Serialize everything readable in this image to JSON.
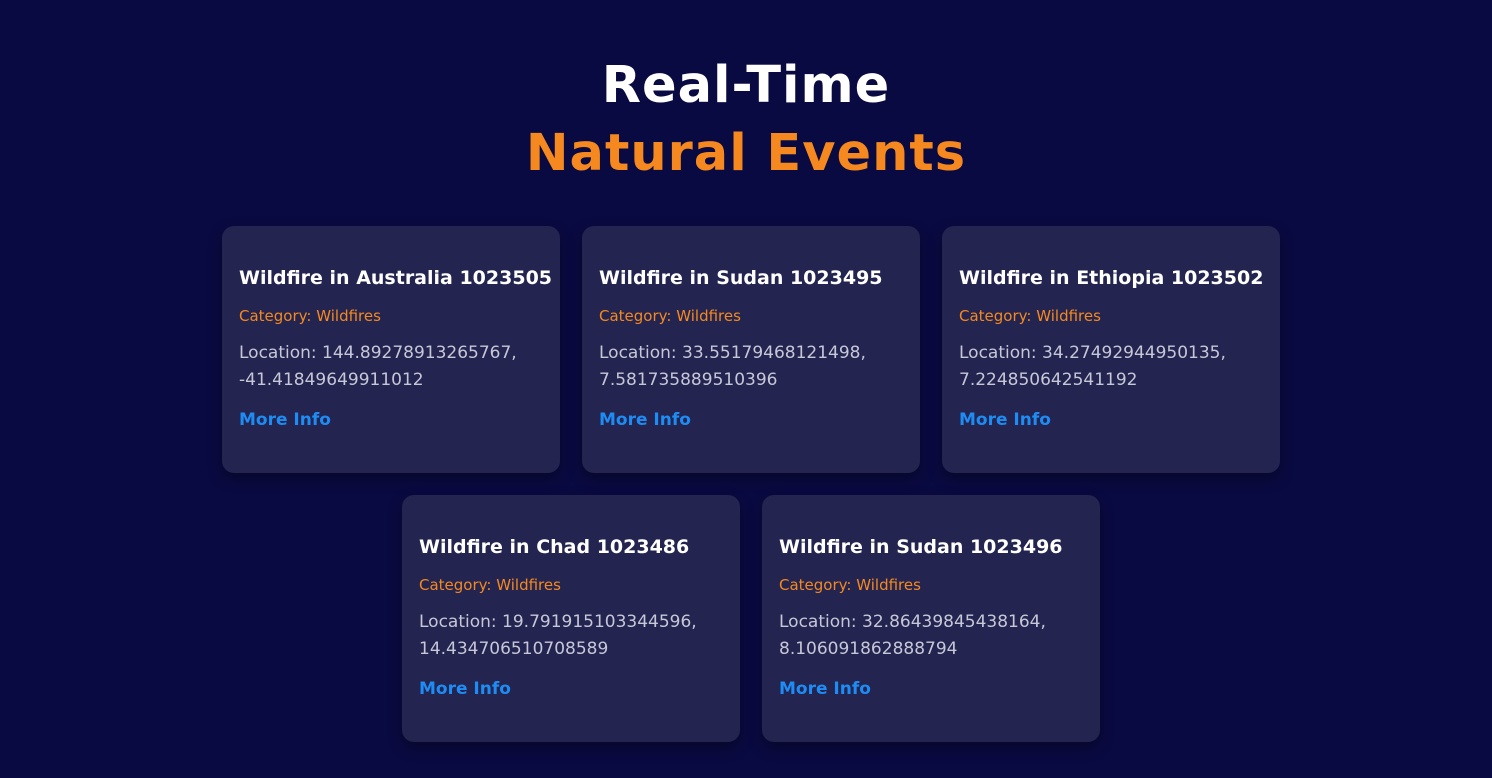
{
  "hero": {
    "line1": "Real-Time",
    "line2": "Natural Events"
  },
  "colors": {
    "background": "#0a0a42",
    "card": "#23244f",
    "accent": "#f5891f",
    "link": "#1e8cf5"
  },
  "events": [
    {
      "title": "Wildfire in Australia 1023505",
      "category": "Category: Wildfires",
      "location_line1": "Location: 144.89278913265767,",
      "location_line2": "-41.41849649911012",
      "link_label": "More Info"
    },
    {
      "title": "Wildfire in Sudan 1023495",
      "category": "Category: Wildfires",
      "location_line1": "Location: 33.55179468121498,",
      "location_line2": "7.581735889510396",
      "link_label": "More Info"
    },
    {
      "title": "Wildfire in Ethiopia 1023502",
      "category": "Category: Wildfires",
      "location_line1": "Location: 34.27492944950135,",
      "location_line2": "7.224850642541192",
      "link_label": "More Info"
    },
    {
      "title": "Wildfire in Chad 1023486",
      "category": "Category: Wildfires",
      "location_line1": "Location: 19.791915103344596,",
      "location_line2": "14.434706510708589",
      "link_label": "More Info"
    },
    {
      "title": "Wildfire in Sudan 1023496",
      "category": "Category: Wildfires",
      "location_line1": "Location: 32.86439845438164,",
      "location_line2": "8.106091862888794",
      "link_label": "More Info"
    }
  ]
}
